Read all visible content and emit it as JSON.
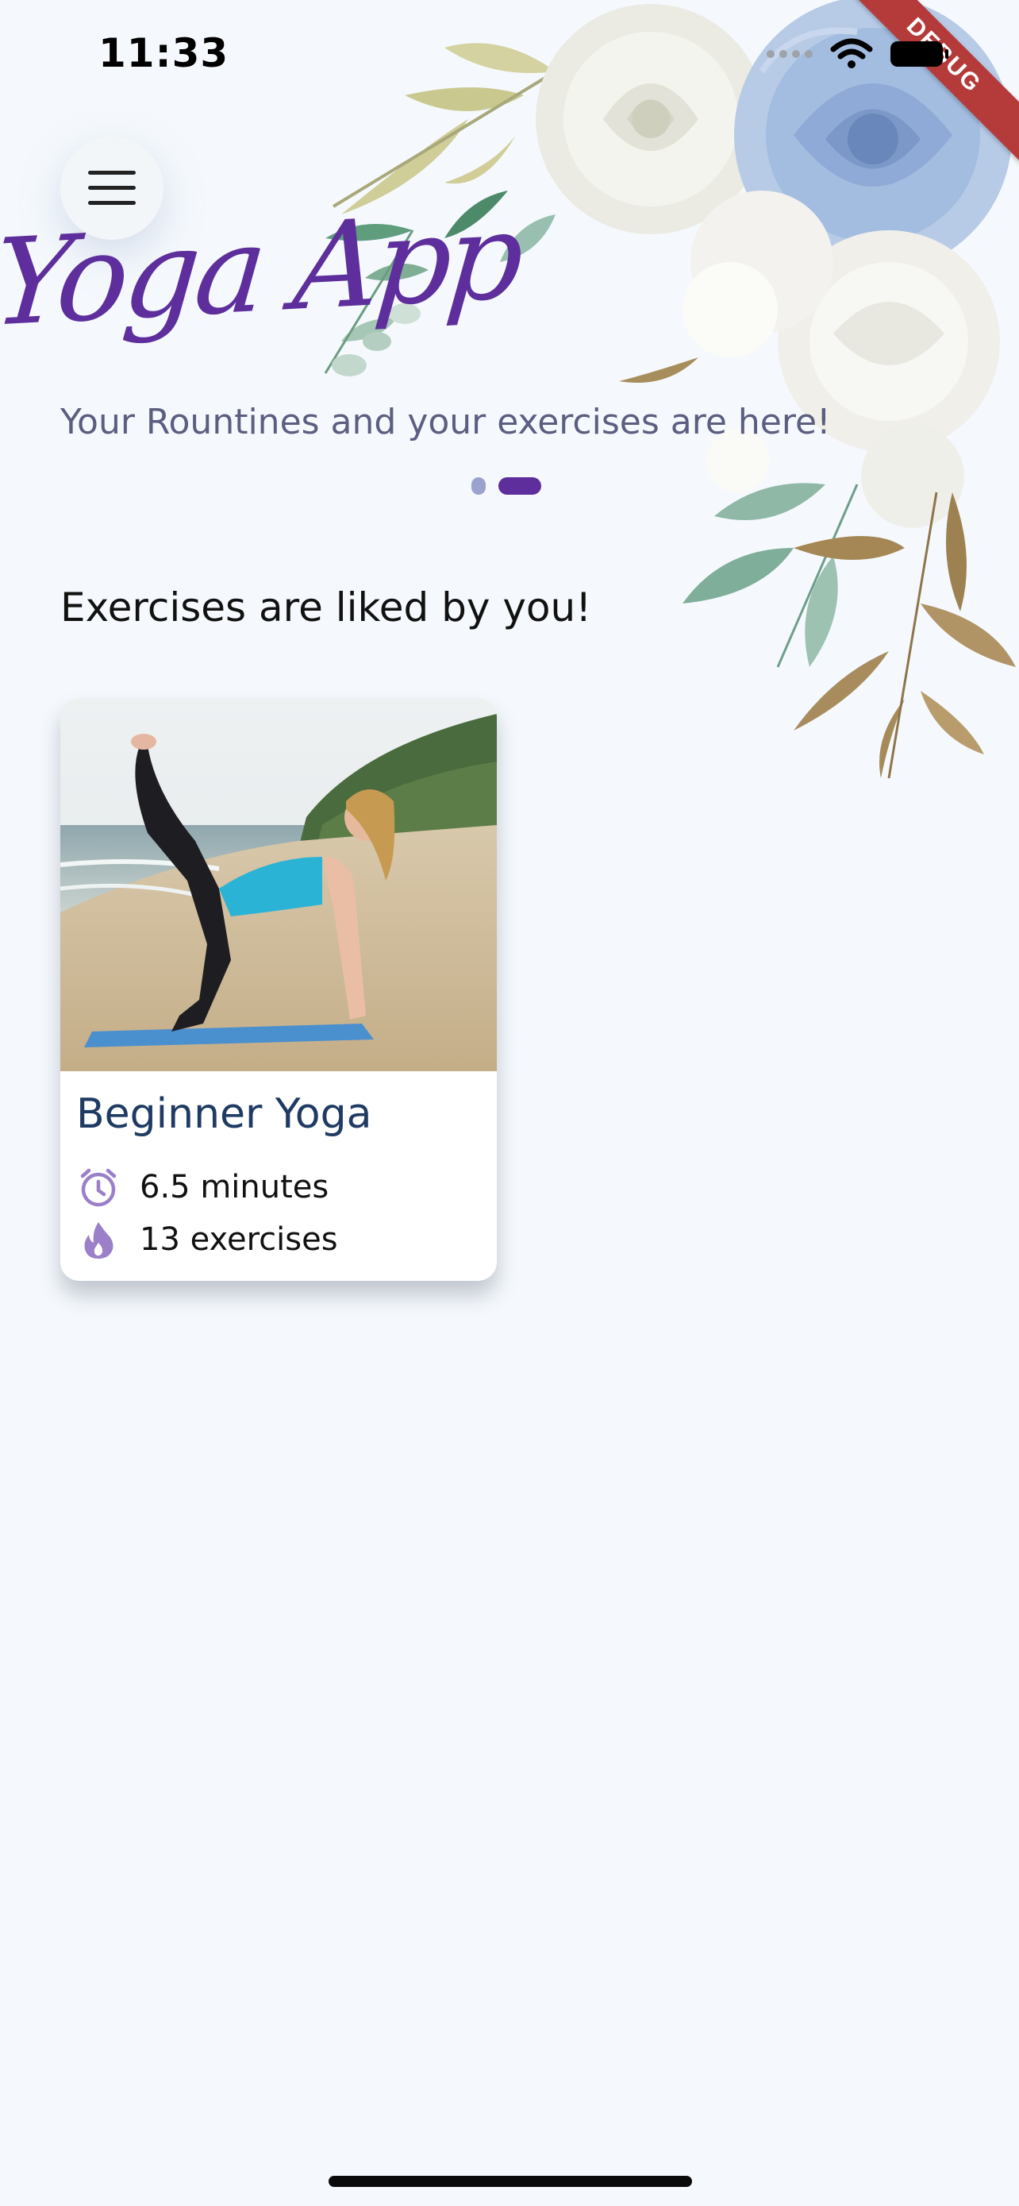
{
  "status_bar": {
    "time": "11:33",
    "debug_banner": "DEBUG",
    "icons": [
      "signal-dots-icon",
      "wifi-icon",
      "battery-icon"
    ]
  },
  "header": {
    "menu_icon": "hamburger-menu-icon",
    "app_title": "Yoga App",
    "subtitle": "Your Rountines and your exercises are here!"
  },
  "carousel": {
    "pages": 2,
    "active_page": 2
  },
  "liked_section": {
    "heading": "Exercises are liked by you!",
    "items": [
      {
        "title": "Beginner Yoga",
        "duration": "6.5 minutes",
        "exercises": "13 exercises",
        "duration_icon": "alarm-clock-icon",
        "exercises_icon": "flame-icon"
      }
    ]
  },
  "colors": {
    "background": "#f5f9fd",
    "accent_purple": "#5e2f9c",
    "subtitle": "#5b5e80",
    "card_title": "#1f3b63",
    "icon_purple": "#9b7fc8",
    "debug_red": "#b53a3a"
  }
}
